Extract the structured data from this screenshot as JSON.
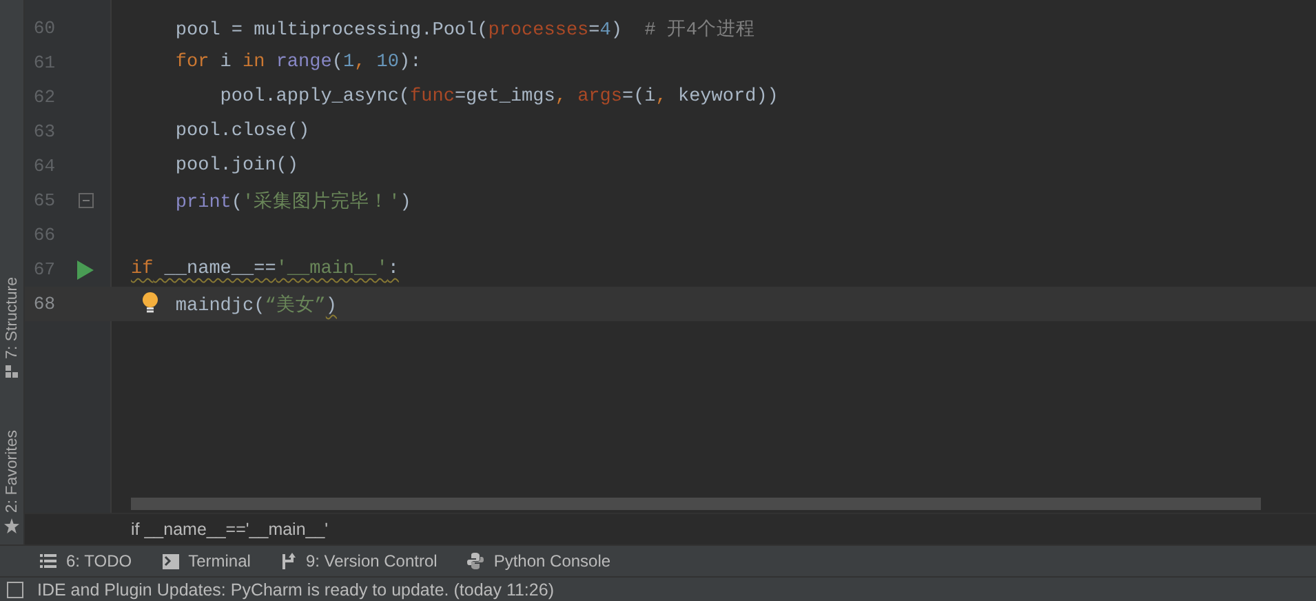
{
  "tool_strip": [
    {
      "label": "7: Structure",
      "kind": "structure"
    },
    {
      "label": "2: Favorites",
      "kind": "favorites"
    }
  ],
  "editor": {
    "lines": [
      {
        "number": "60",
        "current": false,
        "run_marker": false,
        "fold_marker": false,
        "hint": false,
        "tokens": [
          {
            "text": "    pool = multiprocessing.Pool(",
            "kind": "plain",
            "warning": false
          },
          {
            "text": "processes",
            "kind": "param",
            "warning": false
          },
          {
            "text": "=",
            "kind": "plain",
            "warning": false
          },
          {
            "text": "4",
            "kind": "number",
            "warning": false
          },
          {
            "text": ")  ",
            "kind": "plain",
            "warning": false
          },
          {
            "text": "# 开4个进程",
            "kind": "comment",
            "warning": false
          }
        ]
      },
      {
        "number": "61",
        "current": false,
        "run_marker": false,
        "fold_marker": false,
        "hint": false,
        "tokens": [
          {
            "text": "    for",
            "kind": "keyword",
            "warning": false
          },
          {
            "text": " i ",
            "kind": "plain",
            "warning": false
          },
          {
            "text": "in ",
            "kind": "keyword",
            "warning": false
          },
          {
            "text": "range",
            "kind": "builtin",
            "warning": false
          },
          {
            "text": "(",
            "kind": "plain",
            "warning": false
          },
          {
            "text": "1",
            "kind": "number",
            "warning": false
          },
          {
            "text": ", ",
            "kind": "keyword",
            "warning": false
          },
          {
            "text": "10",
            "kind": "number",
            "warning": false
          },
          {
            "text": "):",
            "kind": "plain",
            "warning": false
          }
        ]
      },
      {
        "number": "62",
        "current": false,
        "run_marker": false,
        "fold_marker": false,
        "hint": false,
        "tokens": [
          {
            "text": "        pool.apply_async(",
            "kind": "plain",
            "warning": false
          },
          {
            "text": "func",
            "kind": "param",
            "warning": false
          },
          {
            "text": "=get_imgs",
            "kind": "plain",
            "warning": false
          },
          {
            "text": ", ",
            "kind": "keyword",
            "warning": false
          },
          {
            "text": "args",
            "kind": "param",
            "warning": false
          },
          {
            "text": "=(i",
            "kind": "plain",
            "warning": false
          },
          {
            "text": ", ",
            "kind": "keyword",
            "warning": false
          },
          {
            "text": "keyword))",
            "kind": "plain",
            "warning": false
          }
        ]
      },
      {
        "number": "63",
        "current": false,
        "run_marker": false,
        "fold_marker": false,
        "hint": false,
        "tokens": [
          {
            "text": "    pool.close()",
            "kind": "plain",
            "warning": false
          }
        ]
      },
      {
        "number": "64",
        "current": false,
        "run_marker": false,
        "fold_marker": false,
        "hint": false,
        "tokens": [
          {
            "text": "    pool.join()",
            "kind": "plain",
            "warning": false
          }
        ]
      },
      {
        "number": "65",
        "current": false,
        "run_marker": false,
        "fold_marker": true,
        "hint": false,
        "tokens": [
          {
            "text": "    print",
            "kind": "builtin",
            "warning": false
          },
          {
            "text": "(",
            "kind": "plain",
            "warning": false
          },
          {
            "text": "'采集图片完毕！'",
            "kind": "string",
            "warning": false
          },
          {
            "text": ")",
            "kind": "plain",
            "warning": false
          }
        ]
      },
      {
        "number": "66",
        "current": false,
        "run_marker": false,
        "fold_marker": false,
        "hint": false
      },
      {
        "number": "67",
        "current": false,
        "run_marker": true,
        "fold_marker": false,
        "hint": false,
        "tokens": [
          {
            "text": "if",
            "kind": "keyword",
            "warning": true
          },
          {
            "text": " __name__==",
            "kind": "plain",
            "warning": true
          },
          {
            "text": "'__main__'",
            "kind": "string",
            "warning": true
          },
          {
            "text": ":",
            "kind": "plain",
            "warning": true
          }
        ]
      },
      {
        "number": "68",
        "current": true,
        "run_marker": false,
        "fold_marker": false,
        "hint": true,
        "tokens": [
          {
            "text": "    maindjc(",
            "kind": "plain",
            "warning": false
          },
          {
            "text": "“美女”",
            "kind": "string",
            "warning": false
          },
          {
            "text": ")",
            "kind": "plain",
            "warning": true
          }
        ]
      }
    ]
  },
  "breadcrumb": "if __name__=='__main__'",
  "tool_windows": [
    {
      "label": "6: TODO",
      "kind": "todo"
    },
    {
      "label": "Terminal",
      "kind": "terminal"
    },
    {
      "label": "9: Version Control",
      "kind": "vcs"
    },
    {
      "label": "Python Console",
      "kind": "python"
    }
  ],
  "status_bar": "IDE and Plugin Updates: PyCharm is ready to update. (today 11:26)"
}
